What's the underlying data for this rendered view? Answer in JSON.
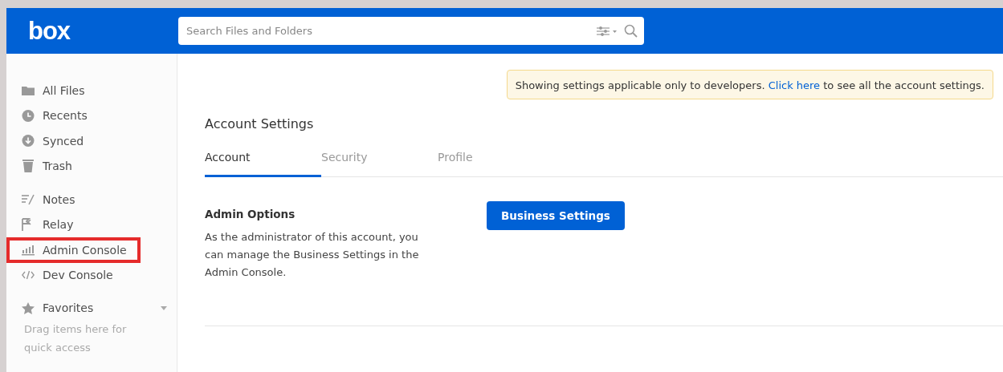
{
  "header": {
    "logo": "box",
    "search": {
      "placeholder": "Search Files and Folders"
    }
  },
  "sidebar": {
    "groups": [
      {
        "items": [
          {
            "label": "All Files",
            "kind": "folder",
            "highlighted": false
          },
          {
            "label": "Recents",
            "kind": "clock",
            "highlighted": false
          },
          {
            "label": "Synced",
            "kind": "download",
            "highlighted": false
          },
          {
            "label": "Trash",
            "kind": "trash",
            "highlighted": false
          }
        ]
      },
      {
        "items": [
          {
            "label": "Notes",
            "kind": "notes",
            "highlighted": false
          },
          {
            "label": "Relay",
            "kind": "flag",
            "highlighted": false
          },
          {
            "label": "Admin Console",
            "kind": "bars",
            "highlighted": true
          },
          {
            "label": "Dev Console",
            "kind": "code",
            "highlighted": false
          }
        ]
      }
    ],
    "favorites": {
      "label": "Favorites",
      "hint": "Drag items here for quick access"
    }
  },
  "notice": {
    "before": "Showing settings applicable only to developers. ",
    "link": "Click here",
    "after": " to see all the account settings."
  },
  "page_title": "Account Settings",
  "tabs": [
    {
      "label": "Account",
      "selected": true
    },
    {
      "label": "Security",
      "selected": false
    },
    {
      "label": "Profile",
      "selected": false
    }
  ],
  "admin_options": {
    "title": "Admin Options",
    "description": "As the administrator of this account, you can manage the Business Settings in the Admin Console.",
    "button": "Business Settings"
  }
}
